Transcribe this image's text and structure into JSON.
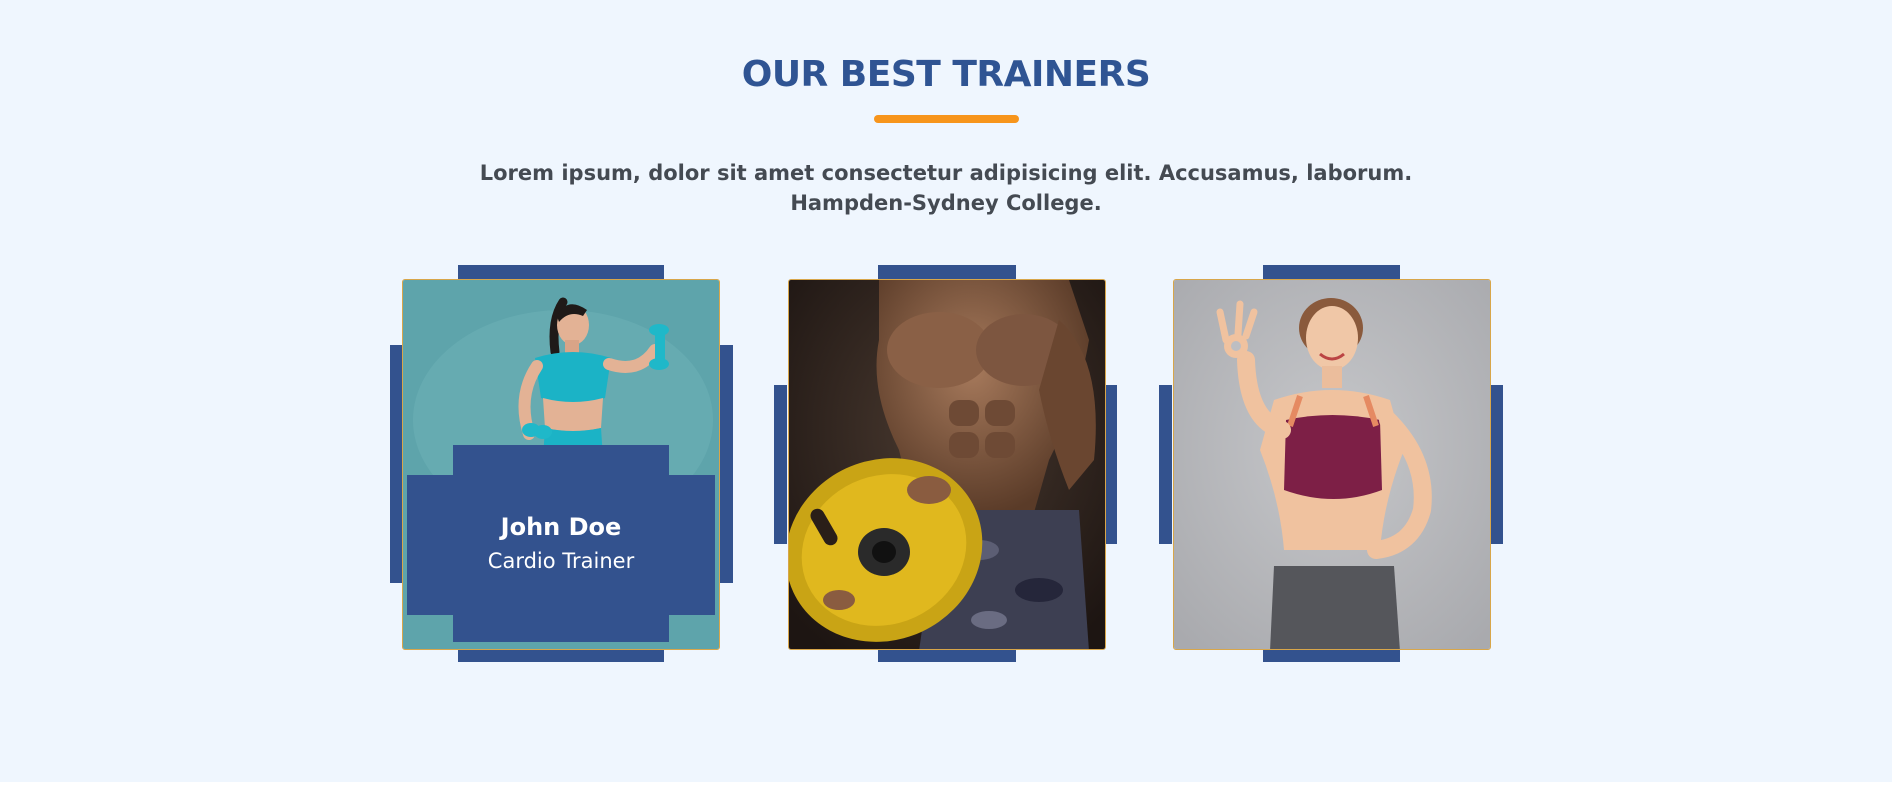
{
  "section": {
    "title": "OUR BEST TRAINERS",
    "subtitle_line1": "Lorem ipsum, dolor sit amet consectetur adipisicing elit. Accusamus, laborum.",
    "subtitle_line2": "Hampden-Sydney College."
  },
  "trainers": [
    {
      "name": "John Doe",
      "role": "Cardio Trainer",
      "photo": "woman-with-dumbbells-photo"
    },
    {
      "photo": "bodybuilder-with-weight-plate-photo"
    },
    {
      "photo": "smiling-woman-ok-gesture-photo"
    }
  ],
  "colors": {
    "accent": "#f7951c",
    "brand_blue": "#2f5493",
    "overlay_blue": "#33528e",
    "section_bg": "#eff6fe"
  }
}
